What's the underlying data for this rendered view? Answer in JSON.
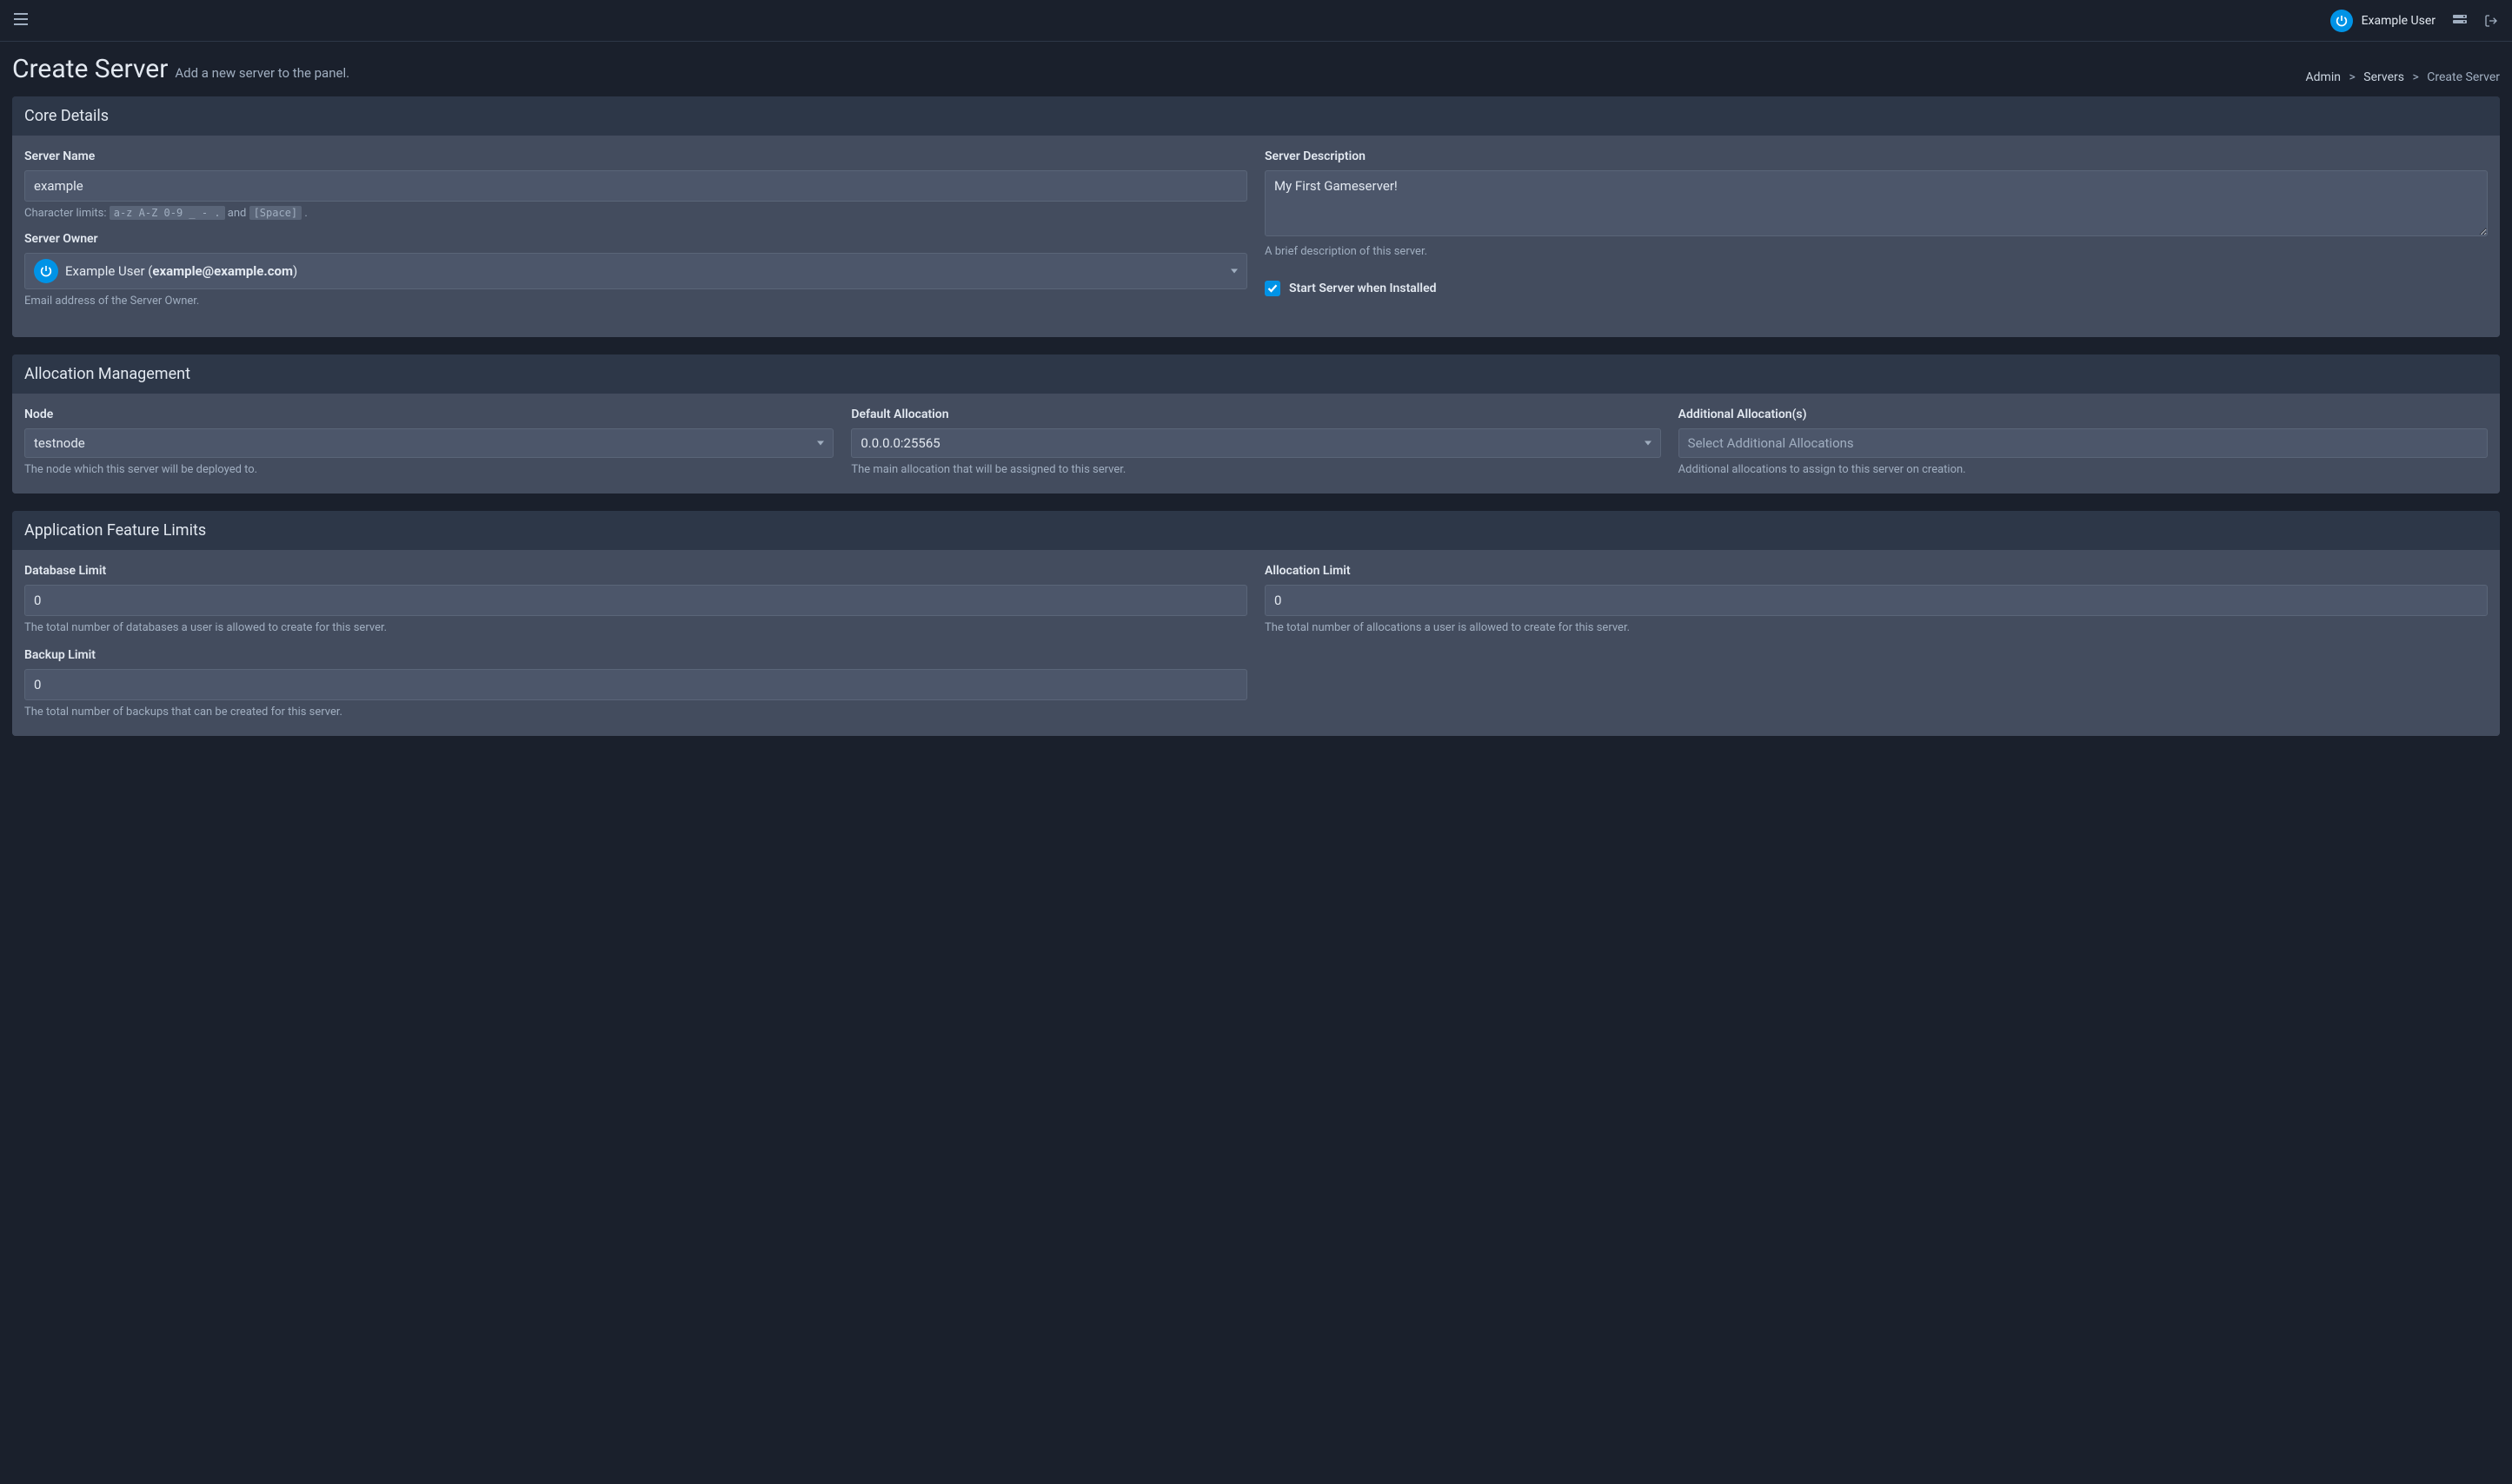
{
  "topbar": {
    "user_name": "Example User"
  },
  "page": {
    "title": "Create Server",
    "subtitle": "Add a new server to the panel."
  },
  "breadcrumb": {
    "admin": "Admin",
    "servers": "Servers",
    "current": "Create Server"
  },
  "core_details": {
    "header": "Core Details",
    "server_name": {
      "label": "Server Name",
      "value": "example",
      "help_prefix": "Character limits: ",
      "help_code1": "a-z A-Z 0-9 _ - .",
      "help_mid": " and ",
      "help_code2": "[Space]",
      "help_suffix": " ."
    },
    "server_owner": {
      "label": "Server Owner",
      "value_prefix": "Example User (",
      "value_bold": "example@example.com",
      "value_suffix": ")",
      "help": "Email address of the Server Owner."
    },
    "server_description": {
      "label": "Server Description",
      "value": "My First Gameserver!",
      "help": "A brief description of this server."
    },
    "start_when_installed": {
      "label": "Start Server when Installed"
    }
  },
  "allocation": {
    "header": "Allocation Management",
    "node": {
      "label": "Node",
      "value": "testnode",
      "help": "The node which this server will be deployed to."
    },
    "default_allocation": {
      "label": "Default Allocation",
      "value": "0.0.0.0:25565",
      "help": "The main allocation that will be assigned to this server."
    },
    "additional": {
      "label": "Additional Allocation(s)",
      "placeholder": "Select Additional Allocations",
      "help": "Additional allocations to assign to this server on creation."
    }
  },
  "feature_limits": {
    "header": "Application Feature Limits",
    "database_limit": {
      "label": "Database Limit",
      "value": "0",
      "help": "The total number of databases a user is allowed to create for this server."
    },
    "allocation_limit": {
      "label": "Allocation Limit",
      "value": "0",
      "help": "The total number of allocations a user is allowed to create for this server."
    },
    "backup_limit": {
      "label": "Backup Limit",
      "value": "0",
      "help": "The total number of backups that can be created for this server."
    }
  }
}
